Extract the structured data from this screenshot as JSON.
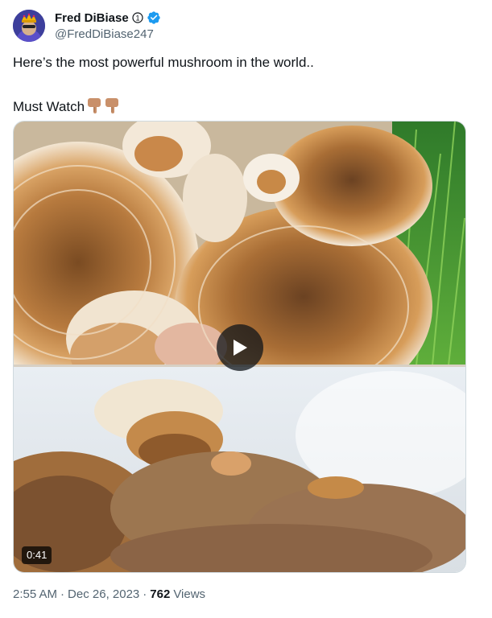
{
  "author": {
    "display_name": "Fred DiBiase",
    "handle": "@FredDiBiase247",
    "avatar_icon": "crowned-avatar-icon",
    "subscriber_icon": "subscriber-badge-icon",
    "verified_icon": "verified-badge-icon",
    "verified_color": "#1d9bf0"
  },
  "tweet": {
    "line1": "Here’s the most powerful mushroom in the world..",
    "line2": "Must Watch",
    "emoji_icon": "backhand-index-pointing-down-icon"
  },
  "media": {
    "duration": "0:41",
    "play_icon": "play-icon"
  },
  "meta": {
    "time": "2:55 AM",
    "separator": "·",
    "date": "Dec 26, 2023",
    "views_count": "762",
    "views_label": "Views"
  },
  "colors": {
    "text_primary": "#0f1419",
    "text_secondary": "#536471",
    "border": "#cfd9de"
  }
}
